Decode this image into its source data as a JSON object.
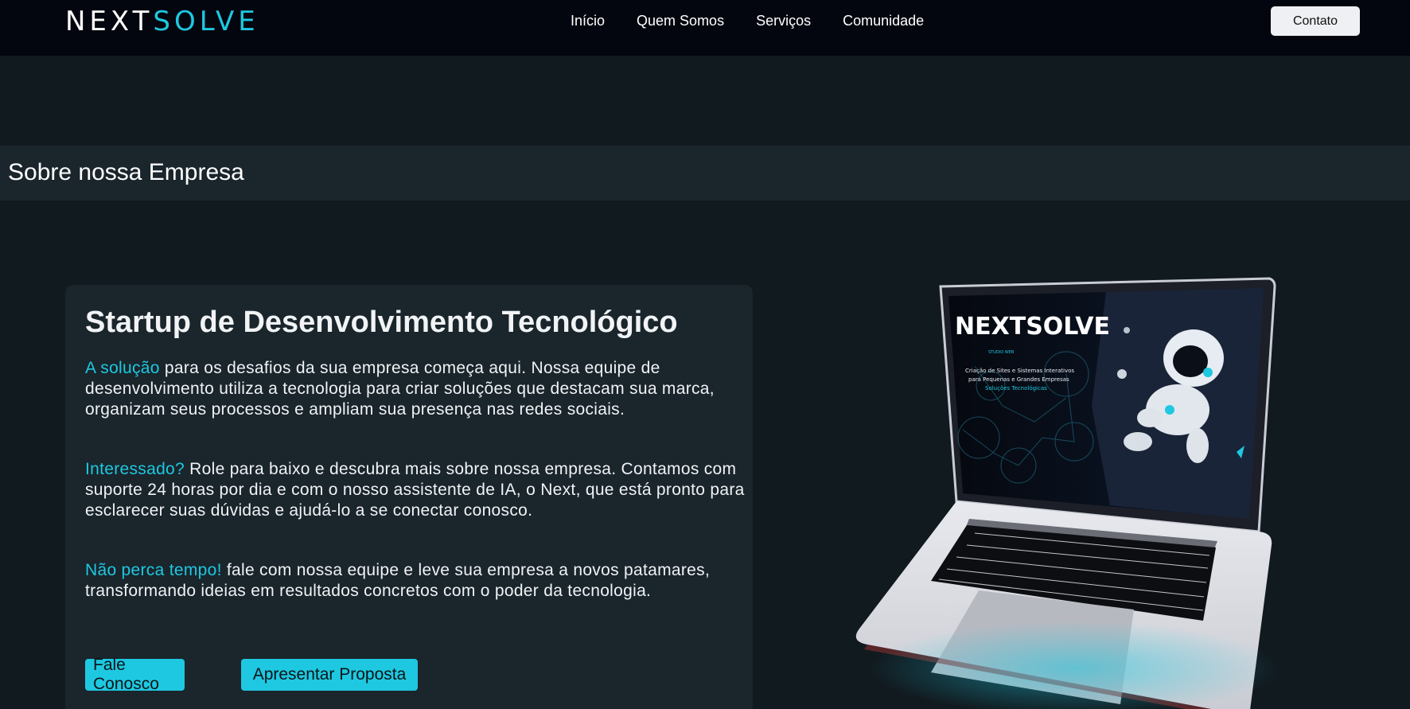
{
  "header": {
    "logo_part1": "NEXT",
    "logo_part2": "SOLVE",
    "nav": [
      "Início",
      "Quem Somos",
      "Serviços",
      "Comunidade"
    ],
    "contact_label": "Contato"
  },
  "section": {
    "title": "Sobre nossa Empresa"
  },
  "card": {
    "title": "Startup de Desenvolvimento Tecnológico",
    "p1_highlight": "A solução",
    "p1_text": " para os desafios da sua empresa começa aqui. Nossa equipe de desenvolvimento utiliza a tecnologia para criar soluções que destacam sua marca, organizam seus processos e ampliam sua presença nas redes sociais.",
    "p2_highlight": "Interessado?",
    "p2_text": " Role para baixo e descubra mais sobre nossa empresa. Contamos com suporte 24 horas por dia e com o nosso assistente de IA, o Next, que está pronto para esclarecer suas dúvidas e ajudá-lo a se conectar conosco.",
    "p3_highlight": "Não perca tempo!",
    "p3_text": " fale com nossa equipe e leve sua empresa a novos patamares, transformando ideias em resultados concretos com o poder da tecnologia.",
    "button1": "Fale Conosco",
    "button2": "Apresentar Proposta"
  },
  "laptop_screen": {
    "logo": "NEXTSOLVE",
    "tagline": "STUDIO WEB",
    "line1": "Criação de Sites e Sistemas Interativos",
    "line2": "para Pequenas e Grandes Empresas",
    "line3": "Soluções Tecnológicas"
  },
  "colors": {
    "accent": "#1ec8e0",
    "background": "#111a1f",
    "header": "#04060f",
    "panel": "#1a252c"
  }
}
